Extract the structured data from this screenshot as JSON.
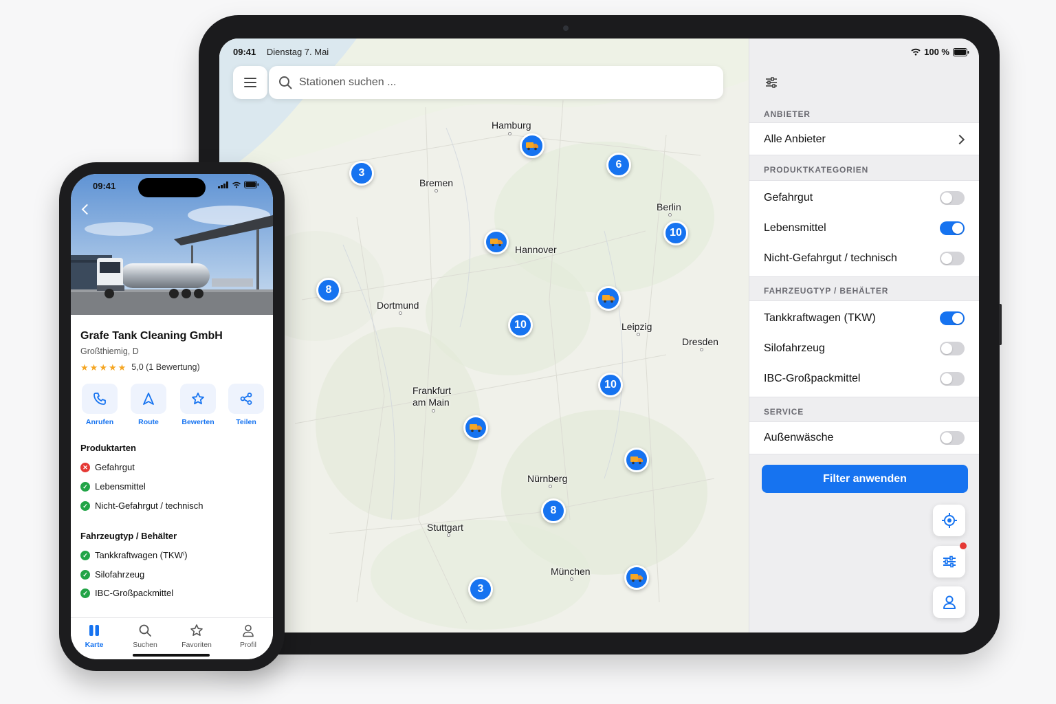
{
  "tablet": {
    "status": {
      "time": "09:41",
      "date": "Dienstag 7. Mai",
      "battery": "100 %"
    },
    "search": {
      "placeholder": "Stationen suchen ..."
    },
    "map": {
      "cities": [
        "Hamburg",
        "Bremen",
        "Berlin",
        "Hannover",
        "Dortmund",
        "Leipzig",
        "Dresden",
        "Frankfurt",
        "am Main",
        "Nürnberg",
        "Stuttgart",
        "München"
      ],
      "clusters": [
        "3",
        "6",
        "10",
        "8",
        "10",
        "10",
        "8",
        "3"
      ],
      "truck_marker_icon": "truck-icon"
    },
    "filter": {
      "header_icon": "sliders-icon",
      "provider": {
        "title": "ANBIETER",
        "value": "Alle Anbieter"
      },
      "product_categories": {
        "title": "PRODUKTKATEGORIEN",
        "items": [
          {
            "label": "Gefahrgut",
            "on": false
          },
          {
            "label": "Lebensmittel",
            "on": true
          },
          {
            "label": "Nicht-Gefahrgut / technisch",
            "on": false
          }
        ]
      },
      "vehicle_type": {
        "title": "FAHRZEUGTYP / BEHÄLTER",
        "items": [
          {
            "label": "Tankkraftwagen (TKW)",
            "on": true
          },
          {
            "label": "Silofahrzeug",
            "on": false
          },
          {
            "label": "IBC-Großpackmittel",
            "on": false
          }
        ]
      },
      "service": {
        "title": "SERVICE",
        "items": [
          {
            "label": "Außenwäsche",
            "on": false
          }
        ]
      },
      "apply_label": "Filter anwenden"
    },
    "fab_icons": [
      "locate-icon",
      "filter-icon",
      "profile-icon"
    ],
    "accent": "#1673f0"
  },
  "phone": {
    "status": {
      "time": "09:41"
    },
    "station": {
      "name": "Grafe Tank Cleaning GmbH",
      "location": "Großthiemig, D",
      "rating_text": "5,0 (1 Bewertung)",
      "stars": 5
    },
    "actions": [
      "Anrufen",
      "Route",
      "Bewerten",
      "Teilen"
    ],
    "product_types": {
      "title": "Produktarten",
      "items": [
        {
          "label": "Gefahrgut",
          "ok": false
        },
        {
          "label": "Lebensmittel",
          "ok": true
        },
        {
          "label": "Nicht-Gefahrgut / technisch",
          "ok": true
        }
      ]
    },
    "vehicle_types": {
      "title": "Fahrzeugtyp / Behälter",
      "items": [
        {
          "label": "Tankkraftwagen (TKWⁱ)",
          "ok": true
        },
        {
          "label": "Silofahrzeug",
          "ok": true
        },
        {
          "label": "IBC-Großpackmittel",
          "ok": true
        }
      ]
    },
    "tabs": [
      "Karte",
      "Suchen",
      "Favoriten",
      "Profil"
    ],
    "active_tab": "Karte"
  }
}
